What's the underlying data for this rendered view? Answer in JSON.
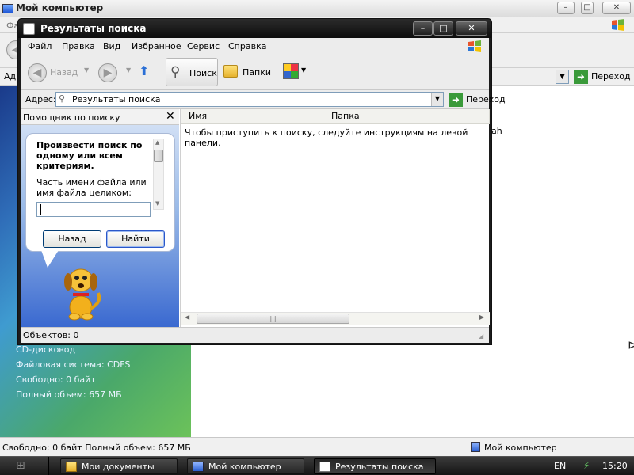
{
  "background_window": {
    "title": "Мой компьютер",
    "menu_first_letter": "Фа",
    "address_label": "Адр",
    "go_label": "Переход",
    "partial_text": "ah",
    "info": [
      "CD-дисковод",
      "Файловая система: CDFS",
      "Свободно: 0 байт",
      "Полный объем: 657 МБ"
    ],
    "status_text": "Свободно: 0 байт Полный объем: 657 МБ",
    "status_location": "Мой компьютер"
  },
  "window": {
    "title": "Результаты поиска",
    "menu": [
      "Файл",
      "Правка",
      "Вид",
      "Избранное",
      "Сервис",
      "Справка"
    ],
    "toolbar": {
      "back": "Назад",
      "search": "Поиск",
      "folders": "Папки"
    },
    "address": {
      "label": "Адрес:",
      "value": "Результаты поиска",
      "go": "Переход"
    },
    "pane": {
      "title": "Помощник по поиску",
      "heading": "Произвести поиск по одному или всем критериям.",
      "field_label": "Часть имени файла или имя файла целиком:",
      "field_value": "",
      "back_button": "Назад",
      "find_button": "Найти"
    },
    "list": {
      "columns": [
        "Имя",
        "Папка"
      ],
      "message": "Чтобы приступить к поиску, следуйте инструкциям на левой панели."
    },
    "status": "Объектов: 0"
  },
  "taskbar": {
    "buttons": [
      "Мои документы",
      "Мой компьютер",
      "Результаты поиска"
    ],
    "language": "EN",
    "clock": "15:20"
  }
}
